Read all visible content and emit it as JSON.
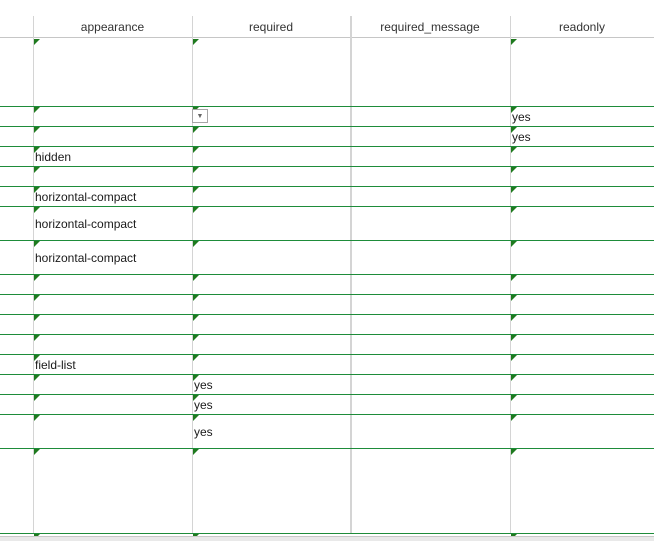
{
  "columns": [
    {
      "key": "appearance",
      "header": "appearance"
    },
    {
      "key": "required",
      "header": "required"
    },
    {
      "key": "required_message",
      "header": "required_message"
    },
    {
      "key": "readonly",
      "header": "readonly"
    }
  ],
  "rows": [
    {
      "appearance": "",
      "required": "",
      "required_message": "",
      "readonly": ""
    },
    {
      "appearance": "",
      "required": "",
      "required_message": "",
      "readonly": "yes"
    },
    {
      "appearance": "",
      "required": "",
      "required_message": "",
      "readonly": "yes"
    },
    {
      "appearance": "hidden",
      "required": "",
      "required_message": "",
      "readonly": ""
    },
    {
      "appearance": "",
      "required": "",
      "required_message": "",
      "readonly": ""
    },
    {
      "appearance": "horizontal-compact",
      "required": "",
      "required_message": "",
      "readonly": ""
    },
    {
      "appearance": "horizontal-compact",
      "required": "",
      "required_message": "",
      "readonly": ""
    },
    {
      "appearance": "horizontal-compact",
      "required": "",
      "required_message": "",
      "readonly": ""
    },
    {
      "appearance": "",
      "required": "",
      "required_message": "",
      "readonly": ""
    },
    {
      "appearance": "",
      "required": "",
      "required_message": "",
      "readonly": ""
    },
    {
      "appearance": "",
      "required": "",
      "required_message": "",
      "readonly": ""
    },
    {
      "appearance": "",
      "required": "",
      "required_message": "",
      "readonly": ""
    },
    {
      "appearance": "field-list",
      "required": "",
      "required_message": "",
      "readonly": ""
    },
    {
      "appearance": "",
      "required": "yes",
      "required_message": "",
      "readonly": ""
    },
    {
      "appearance": "",
      "required": "yes",
      "required_message": "",
      "readonly": ""
    },
    {
      "appearance": "",
      "required": "yes",
      "required_message": "",
      "readonly": ""
    },
    {
      "appearance": "",
      "required": "",
      "required_message": "",
      "readonly": ""
    }
  ],
  "colors": {
    "grid_line": "#1e8c3a",
    "column_divider": "#d4d4d4",
    "comment_marker": "#1f7a1f"
  },
  "icons": {
    "dropdown": "dropdown-arrow-icon"
  }
}
